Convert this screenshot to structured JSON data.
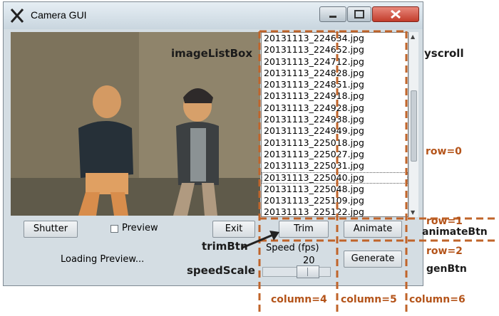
{
  "window": {
    "title": "Camera GUI"
  },
  "list_items": [
    "20131113_224634.jpg",
    "20131113_224652.jpg",
    "20131113_224712.jpg",
    "20131113_224828.jpg",
    "20131113_224851.jpg",
    "20131113_224918.jpg",
    "20131113_224928.jpg",
    "20131113_224938.jpg",
    "20131113_224949.jpg",
    "20131113_225018.jpg",
    "20131113_225027.jpg",
    "20131113_225031.jpg",
    "20131113_225040.jpg",
    "20131113_225048.jpg",
    "20131113_225109.jpg",
    "20131113_225122.jpg"
  ],
  "controls": {
    "shutter": "Shutter",
    "preview": "Preview",
    "exit": "Exit",
    "trim": "Trim",
    "animate": "Animate",
    "generate": "Generate",
    "status": "Loading Preview...",
    "speed_label": "Speed (fps)",
    "speed_value": "20"
  },
  "annotations": {
    "imageListBox": "imageListBox",
    "yscroll": "yscroll",
    "row0": "row=0",
    "row1": "row=1",
    "animateBtn": "animateBtn",
    "row2": "row=2",
    "genBtn": "genBtn",
    "trimBtn": "trimBtn",
    "speedScale": "speedScale",
    "col4": "column=4",
    "col5": "column=5",
    "col6": "column=6"
  },
  "colors": {
    "annotation": "#c0642a",
    "window_bg": "#d4dde3"
  }
}
